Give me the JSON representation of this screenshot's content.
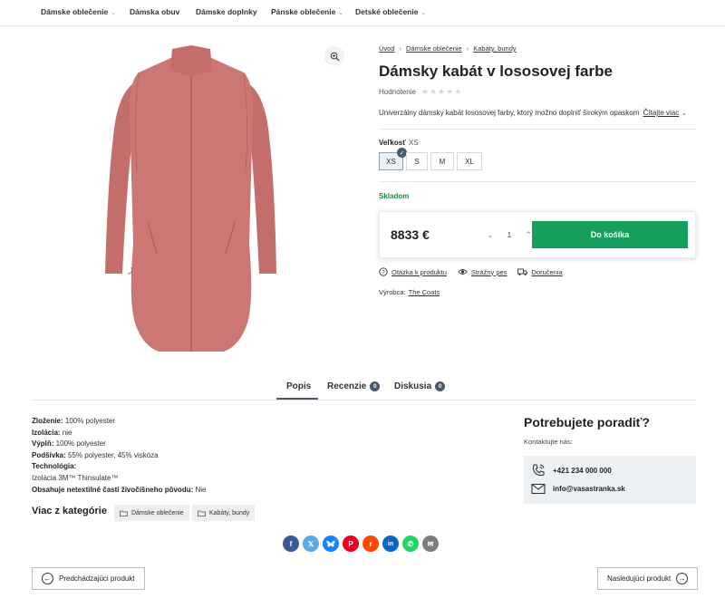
{
  "nav": {
    "items": [
      {
        "label": "Dámske oblečenie",
        "has_dropdown": true
      },
      {
        "label": "Dámska obuv",
        "has_dropdown": false
      },
      {
        "label": "Dámske doplnky",
        "has_dropdown": false
      },
      {
        "label": "Pánske oblečenie",
        "has_dropdown": true
      },
      {
        "label": "Detské oblečenie",
        "has_dropdown": true
      }
    ],
    "caret": "⌄"
  },
  "product_image": {
    "alt_icon": "coat-image",
    "zoom_icon": "zoom-in-icon"
  },
  "breadcrumb": {
    "items": [
      "Úvod",
      "Dámske oblečenie",
      "Kabáty, bundy"
    ],
    "separator": "›"
  },
  "product": {
    "title": "Dámsky kabát v lososovej farbe",
    "rating_label": "Hodnotenie",
    "rating_stars": "★★★★★",
    "rating_value": 0,
    "short_description": "Univerzálny dámsky kabát lososovej farby, ktorý možno doplniť širokým opaskom",
    "read_more": "Čítajte viac",
    "read_more_caret": "⌄",
    "size_label": "Veľkosť",
    "size_selected": "XS",
    "sizes": [
      "XS",
      "S",
      "M",
      "XL"
    ],
    "stock": "Skladom",
    "price": "8833 €",
    "quantity": "1",
    "add_to_cart": "Do košíka",
    "links": [
      {
        "icon": "question-icon",
        "label": "Otázka k produktu"
      },
      {
        "icon": "eye-icon",
        "label": "Strážny pes"
      },
      {
        "icon": "truck-icon",
        "label": "Doručenia"
      }
    ],
    "maker_label": "Výrobca:",
    "maker": "The Coats"
  },
  "tabs": [
    {
      "label": "Popis",
      "count": null,
      "active": true
    },
    {
      "label": "Recenzie",
      "count": "0",
      "active": false
    },
    {
      "label": "Diskusia",
      "count": "0",
      "active": false
    }
  ],
  "description": [
    {
      "k": "Zloženie:",
      "v": " 100% polyester"
    },
    {
      "k": "Izolácia:",
      "v": " nie"
    },
    {
      "k": "Výplň:",
      "v": " 100% polyester"
    },
    {
      "k": "Podšívka:",
      "v": " 55% polyester, 45% viskóza"
    },
    {
      "k": "Technológia:",
      "v": ""
    },
    {
      "k": "",
      "v": "Izolácia 3M™ Thinsulate™"
    },
    {
      "k": "Obsahuje netextilné časti živočíšneho pôvodu:",
      "v": " Nie"
    }
  ],
  "categories": {
    "label": "Viac z kategórie",
    "chips": [
      "Dámske oblečenie",
      "Kabáty, bundy"
    ],
    "chip_icon": "folder-icon"
  },
  "advice": {
    "title": "Potrebujete poradiť?",
    "subtitle": "Kontaktujte nás:",
    "phone": "+421 234 000 000",
    "email": "info@vasastranka.sk"
  },
  "share": [
    {
      "name": "facebook-icon",
      "glyph": "f",
      "color": "#3b5998"
    },
    {
      "name": "x-icon",
      "glyph": "𝕏",
      "color": "#5aa9e6"
    },
    {
      "name": "bluesky-icon",
      "glyph": "🦋",
      "color": "#1185fe"
    },
    {
      "name": "pinterest-icon",
      "glyph": "P",
      "color": "#e60023"
    },
    {
      "name": "reddit-icon",
      "glyph": "r",
      "color": "#ff4500"
    },
    {
      "name": "linkedin-icon",
      "glyph": "in",
      "color": "#0a66c2"
    },
    {
      "name": "whatsapp-icon",
      "glyph": "✆",
      "color": "#25d366"
    },
    {
      "name": "email-icon",
      "glyph": "✉",
      "color": "#7d7d7d"
    }
  ],
  "pager": {
    "prev": "Predchádzajúci produkt",
    "next": "Nasledujúci produkt",
    "prev_icon": "←",
    "next_icon": "→"
  },
  "colors": {
    "accent_green": "#16a05d",
    "stock_green": "#1b8a3e",
    "coat": "#c97270"
  }
}
